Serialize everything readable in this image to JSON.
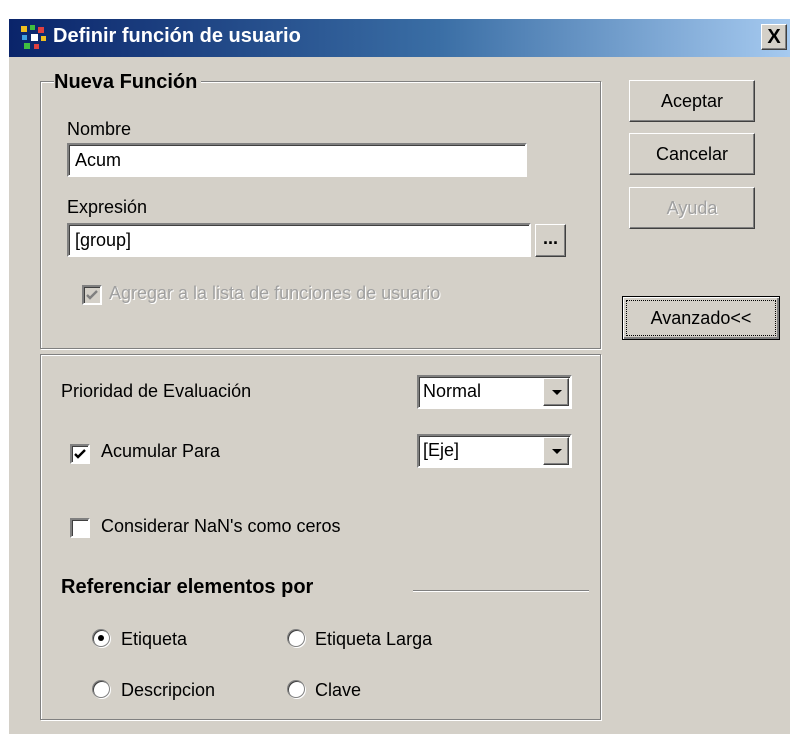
{
  "window": {
    "title": "Definir función de usuario",
    "close_label": "X"
  },
  "nueva_funcion": {
    "legend": "Nueva Función",
    "nombre_label": "Nombre",
    "nombre_value": "Acum",
    "expresion_label": "Expresión",
    "expresion_value": "[group]",
    "browse_label": "...",
    "agregar_label": "Agregar a la lista de funciones de usuario"
  },
  "buttons": {
    "aceptar": "Aceptar",
    "cancelar": "Cancelar",
    "ayuda": "Ayuda",
    "avanzado": "Avanzado<<"
  },
  "advanced": {
    "prioridad_label": "Prioridad de Evaluación",
    "prioridad_value": "Normal",
    "acumular_label": "Acumular Para",
    "acumular_checked": true,
    "acumular_value": "[Eje]",
    "nan_label": "Considerar NaN's como ceros",
    "nan_checked": false,
    "ref_title": "Referenciar elementos por",
    "ref_options": [
      {
        "label": "Etiqueta",
        "selected": true
      },
      {
        "label": "Etiqueta Larga",
        "selected": false
      },
      {
        "label": "Descripcion",
        "selected": false
      },
      {
        "label": "Clave",
        "selected": false
      }
    ]
  },
  "colors": {
    "titlebar_start": "#0a246a",
    "titlebar_end": "#a6caf0",
    "dialog_bg": "#d4d0c8"
  }
}
